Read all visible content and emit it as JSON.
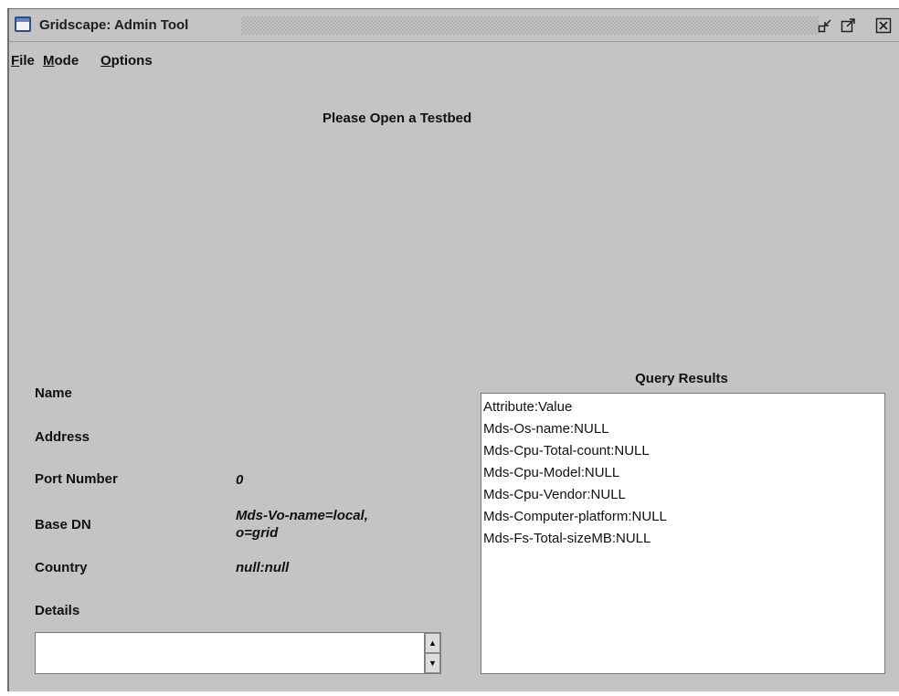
{
  "window": {
    "title": "Gridscape: Admin Tool",
    "icons": [
      "window-icon",
      "minimize-icon",
      "maximize-icon",
      "close-icon"
    ]
  },
  "menu": [
    {
      "mnemonic": "F",
      "rest": "ile"
    },
    {
      "mnemonic": "M",
      "rest": "ode"
    },
    {
      "mnemonic": "O",
      "rest": "ptions"
    }
  ],
  "banner": "Please Open a Testbed",
  "info": {
    "name_label": "Name",
    "address_label": "Address",
    "port_label": "Port Number",
    "port_value": "0",
    "basedn_label": "Base DN",
    "basedn_value_line1": "Mds-Vo-name=local,",
    "basedn_value_line2": "o=grid",
    "country_label": "Country",
    "country_value": "null:null",
    "details_label": "Details",
    "details_value": ""
  },
  "query": {
    "title": "Query Results",
    "lines": [
      "Attribute:Value",
      "Mds-Os-name:NULL",
      "Mds-Cpu-Total-count:NULL",
      "Mds-Cpu-Model:NULL",
      "Mds-Cpu-Vendor:NULL",
      "Mds-Computer-platform:NULL",
      "Mds-Fs-Total-sizeMB:NULL"
    ]
  },
  "colors": {
    "panel_bg": "#c4c4c4",
    "window_icon": "#2e4d8a"
  }
}
